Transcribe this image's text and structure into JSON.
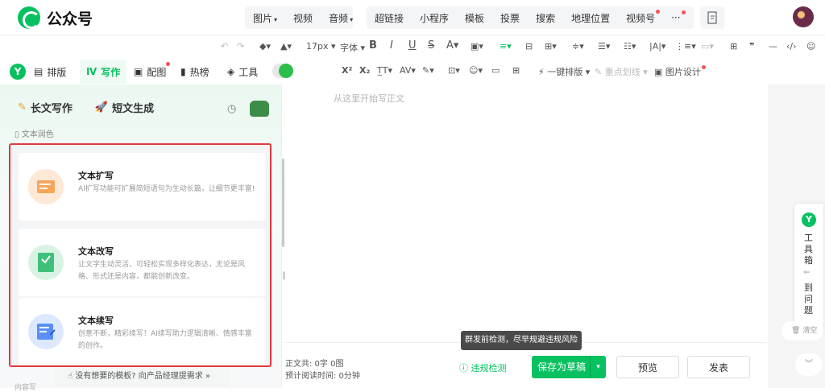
{
  "brand": {
    "name": "公众号"
  },
  "top_nav": {
    "media": [
      {
        "label": "图片",
        "caret": "▾"
      },
      {
        "label": "视频"
      },
      {
        "label": "音频",
        "caret": "▾"
      }
    ],
    "insert": [
      {
        "label": "超链接"
      },
      {
        "label": "小程序"
      },
      {
        "label": "模板"
      },
      {
        "label": "投票"
      },
      {
        "label": "搜索"
      },
      {
        "label": "地理位置"
      },
      {
        "label": "视频号"
      },
      {
        "label": "···"
      }
    ]
  },
  "toolbar": {
    "font_size": "17px",
    "font_family": "字体",
    "bold": "B",
    "italic": "I",
    "underline": "U",
    "strike": "S",
    "font_color": "A",
    "superscript": "X²",
    "subscript": "X₂",
    "one_click": "一键排版",
    "highlight": "重点划线",
    "image_design": "图片设计"
  },
  "mode_tabs": [
    {
      "label": "排版"
    },
    {
      "label": "写作"
    },
    {
      "label": "配图"
    },
    {
      "label": "热榜"
    },
    {
      "label": "工具"
    }
  ],
  "left_panel": {
    "tab_long": "长文写作",
    "tab_short": "短文生成",
    "section": "文本润色",
    "cards": [
      {
        "title": "文本扩写",
        "desc": "AI扩写功能可扩展简短语句为生动长篇，让细节更丰富!",
        "color": "#f5a65b"
      },
      {
        "title": "文本改写",
        "desc": "让文字生动灵活，可轻松实现多样化表达，无论是风格、形式还是内容，都能创新改变。",
        "color": "#3fc07a"
      },
      {
        "title": "文本续写",
        "desc": "创意不断，精彩续写！AI续写助力逻辑清晰、情感丰富的创作。",
        "color": "#5b8ff5"
      }
    ],
    "bottom_hint": "没有想要的模板?  向产品经理提需求 »",
    "cut_label": "内容写"
  },
  "editor": {
    "placeholder": "从这里开始写正文"
  },
  "footer": {
    "body_count": "正文共:   0字 0图",
    "read_time": "预计阅读时间:    0分钟",
    "check": "违规检测",
    "tooltip": "群发前检测，尽早规避违规风险",
    "save": "保存为草稿",
    "preview": "预览",
    "publish": "发表"
  },
  "side_widget": {
    "chars1": [
      "工",
      "具",
      "箱"
    ],
    "chars2": [
      "到",
      "问",
      "题"
    ],
    "clear": "清空"
  },
  "colors": {
    "accent": "#07c160",
    "alert": "#e0393e"
  }
}
